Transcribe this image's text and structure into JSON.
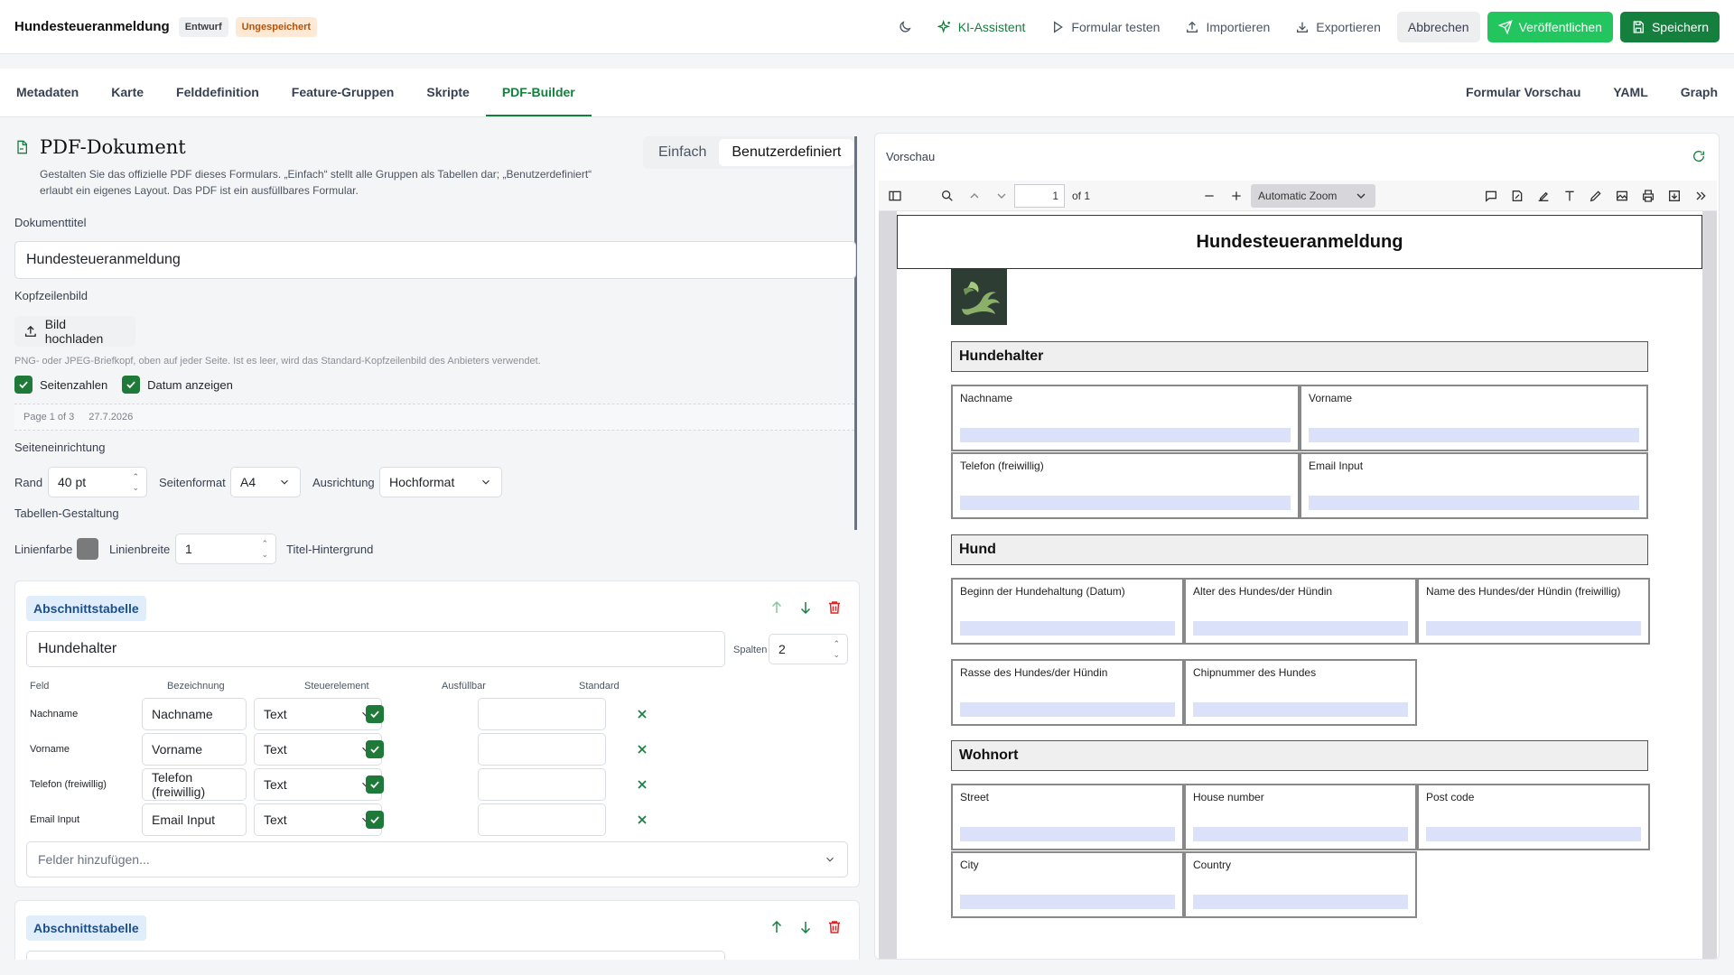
{
  "header": {
    "title": "Hundesteueranmeldung",
    "badge_draft": "Entwurf",
    "badge_unsaved": "Ungespeichert",
    "actions": {
      "ai": "KI-Assistent",
      "test": "Formular testen",
      "import": "Importieren",
      "export": "Exportieren",
      "cancel": "Abbrechen",
      "publish": "Veröffentlichen",
      "save": "Speichern"
    }
  },
  "tabs": {
    "left": [
      "Metadaten",
      "Karte",
      "Felddefinition",
      "Feature-Gruppen",
      "Skripte",
      "PDF-Builder"
    ],
    "right": [
      "Formular Vorschau",
      "YAML",
      "Graph"
    ],
    "active": "PDF-Builder"
  },
  "editor": {
    "title": "PDF-Dokument",
    "description": "Gestalten Sie das offizielle PDF dieses Formulars. „Einfach“ stellt alle Gruppen als Tabellen dar; „Benutzerdefiniert“ erlaubt ein eigenes Layout. Das PDF ist ein ausfüllbares Formular.",
    "mode_simple": "Einfach",
    "mode_custom": "Benutzerdefiniert",
    "doc_title_label": "Dokumenttitel",
    "doc_title_value": "Hundesteueranmeldung",
    "header_image_label": "Kopfzeilenbild",
    "upload_label": "Bild hochladen",
    "upload_hint": "PNG- oder JPEG-Briefkopf, oben auf jeder Seite. Ist es leer, wird das Standard-Kopfzeilenbild des Anbieters verwendet.",
    "page_numbers_label": "Seitenzahlen",
    "show_date_label": "Datum anzeigen",
    "footer_preview_page": "Page 1 of 3",
    "footer_preview_date": "27.7.2026",
    "page_setup_label": "Seiteneinrichtung",
    "margin_label": "Rand",
    "margin_value": "40 pt",
    "format_label": "Seitenformat",
    "format_value": "A4",
    "orientation_label": "Ausrichtung",
    "orientation_value": "Hochformat",
    "table_style_label": "Tabellen-Gestaltung",
    "line_color_label": "Linienfarbe",
    "line_color": "#7a7a7a",
    "line_width_label": "Linienbreite",
    "line_width_value": "1",
    "title_bg_label": "Titel-Hintergrund"
  },
  "section_card": {
    "tag": "Abschnittstabelle",
    "name": "Hundehalter",
    "columns_label": "Spalten",
    "columns_value": "2",
    "headers": {
      "field": "Feld",
      "label": "Bezeichnung",
      "control": "Steuerelement",
      "fillable": "Ausfüllbar",
      "default": "Standard"
    },
    "rows": [
      {
        "field": "Nachname",
        "label": "Nachname",
        "control": "Text"
      },
      {
        "field": "Vorname",
        "label": "Vorname",
        "control": "Text"
      },
      {
        "field": "Telefon (freiwillig)",
        "label": "Telefon (freiwillig)",
        "control": "Text"
      },
      {
        "field": "Email Input",
        "label": "Email Input",
        "control": "Text"
      }
    ],
    "add_fields": "Felder hinzufügen..."
  },
  "section_card_2": {
    "tag": "Abschnittstabelle"
  },
  "preview": {
    "label": "Vorschau",
    "page_input": "1",
    "page_of": "of 1",
    "zoom": "Automatic Zoom",
    "pdf_title": "Hundesteueranmeldung",
    "sections": [
      {
        "title": "Hundehalter",
        "fields": [
          "Nachname",
          "Vorname",
          "Telefon (freiwillig)",
          "Email Input"
        ]
      },
      {
        "title": "Hund",
        "fields": [
          "Beginn der Hundehaltung (Datum)",
          "Alter des Hundes/der Hündin",
          "Name des Hundes/der Hündin (freiwillig)",
          "Rasse des Hundes/der Hündin",
          "Chipnummer des Hundes"
        ]
      },
      {
        "title": "Wohnort",
        "fields": [
          "Street",
          "House number",
          "Post code",
          "City",
          "Country"
        ]
      }
    ]
  },
  "colors": {
    "accent": "#15803d",
    "publish": "#22c55e",
    "tag_bg": "#e0eefc",
    "field_fill": "#dbe1f8"
  }
}
